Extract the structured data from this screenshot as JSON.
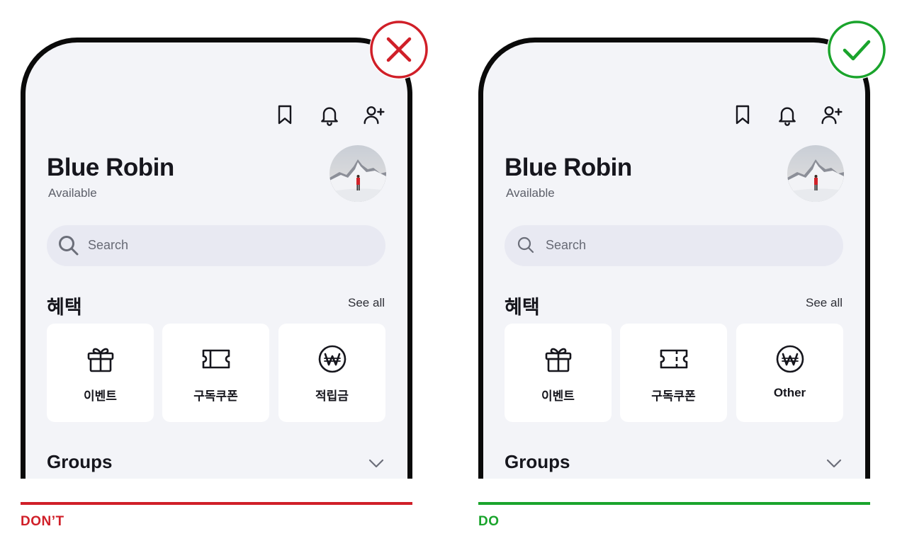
{
  "colors": {
    "dont": "#d01f28",
    "do": "#1aa42c",
    "phone_bg": "#f3f4f8",
    "frame": "#0a0a0a"
  },
  "panels": [
    {
      "id": "dont",
      "header_icons": [
        "bookmark-icon",
        "bell-icon",
        "add-user-icon"
      ],
      "profile": {
        "name": "Blue Robin",
        "status": "Available",
        "avatar": "avatar-mountain-photo"
      },
      "search": {
        "placeholder": "Search"
      },
      "benefits": {
        "title": "혜택",
        "see_all": "See all",
        "cards": [
          {
            "icon": "gift-icon",
            "label": "이벤트"
          },
          {
            "icon": "ticket-icon",
            "label": "구독쿠폰"
          },
          {
            "icon": "won-coin-icon",
            "label": "적립금"
          }
        ]
      },
      "groups": {
        "title": "Groups"
      },
      "verdict": {
        "icon": "x-circle-icon",
        "caption": "DON’T"
      }
    },
    {
      "id": "do",
      "header_icons": [
        "bookmark-icon",
        "bell-icon",
        "add-user-icon"
      ],
      "profile": {
        "name": "Blue Robin",
        "status": "Available",
        "avatar": "avatar-mountain-photo"
      },
      "search": {
        "placeholder": "Search"
      },
      "benefits": {
        "title": "혜택",
        "see_all": "See all",
        "cards": [
          {
            "icon": "gift-icon",
            "label": "이벤트"
          },
          {
            "icon": "ticket-icon",
            "label": "구독쿠폰"
          },
          {
            "icon": "won-coin-icon",
            "label": "Other"
          }
        ]
      },
      "groups": {
        "title": "Groups"
      },
      "verdict": {
        "icon": "check-circle-icon",
        "caption": "DO"
      }
    }
  ]
}
